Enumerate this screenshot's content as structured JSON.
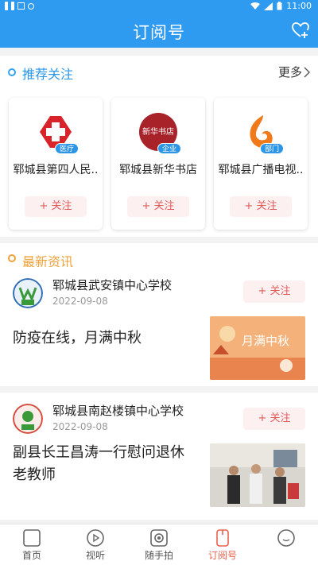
{
  "status_bar": {
    "time": "11:00",
    "notification_icons": [
      "wifi-icon",
      "signal-icon",
      "battery-icon"
    ]
  },
  "header": {
    "title": "订阅号",
    "action_icon": "add-heart-icon"
  },
  "recommend": {
    "title": "推荐关注",
    "more_label": "更多",
    "cards": [
      {
        "name": "郓城县第四人民..",
        "tag": "医疗",
        "follow_label": "+ 关注",
        "logo_icon": "red-cross-icon"
      },
      {
        "name": "郓城县新华书店",
        "tag": "企业",
        "follow_label": "+ 关注",
        "logo_icon": "xinhua-bookstore-logo",
        "logo_text": "新华书店"
      },
      {
        "name": "郓城县广播电视..",
        "tag": "部门",
        "follow_label": "+ 关注",
        "logo_icon": "broadcast-flame-logo"
      }
    ]
  },
  "news": {
    "title": "最新资讯",
    "items": [
      {
        "source": "郓城县武安镇中心学校",
        "date": "2022-09-08",
        "follow_label": "+ 关注",
        "headline": "防疫在线，月满中秋",
        "thumb_text": "月满中秋"
      },
      {
        "source": "郓城县南赵楼镇中心学校",
        "date": "2022-09-08",
        "follow_label": "+ 关注",
        "headline": "副县长王昌涛一行慰问退休老教师"
      }
    ]
  },
  "tabbar": {
    "tabs": [
      {
        "label": "首页",
        "icon": "home-icon"
      },
      {
        "label": "视听",
        "icon": "play-icon"
      },
      {
        "label": "随手拍",
        "icon": "camera-icon"
      },
      {
        "label": "订阅号",
        "icon": "subscription-icon",
        "active": true
      },
      {
        "label": "",
        "icon": "profile-icon"
      }
    ]
  },
  "colors": {
    "brand_blue": "#2f9bf0",
    "follow_red": "#e05a5a",
    "news_orange": "#f0a23a",
    "active_tab": "#e8604e"
  }
}
